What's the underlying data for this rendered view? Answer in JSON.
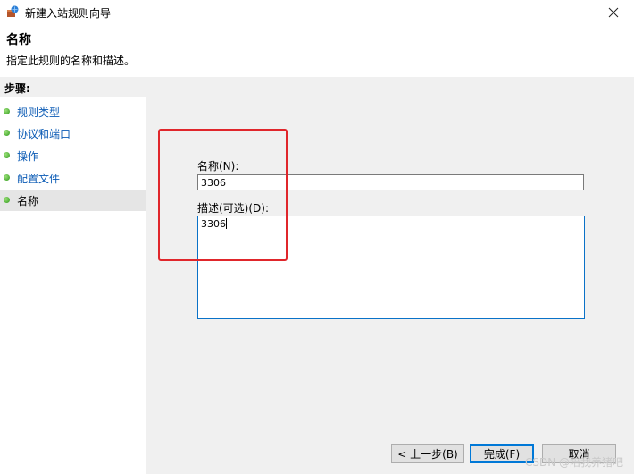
{
  "window": {
    "title": "新建入站规则向导"
  },
  "header": {
    "title": "名称",
    "description": "指定此规则的名称和描述。"
  },
  "sidebar": {
    "heading": "步骤:",
    "steps": [
      {
        "label": "规则类型"
      },
      {
        "label": "协议和端口"
      },
      {
        "label": "操作"
      },
      {
        "label": "配置文件"
      },
      {
        "label": "名称"
      }
    ]
  },
  "form": {
    "name_label": "名称(N):",
    "name_value": "3306",
    "desc_label": "描述(可选)(D):",
    "desc_value": "3306"
  },
  "buttons": {
    "back": "< 上一步(B)",
    "finish": "完成(F)",
    "cancel": "取消"
  },
  "watermark": "CSDN @陪我养猪吧",
  "colors": {
    "link": "#0b5bb5",
    "highlight_box": "#e0262b",
    "focus_border": "#0a72c8"
  }
}
